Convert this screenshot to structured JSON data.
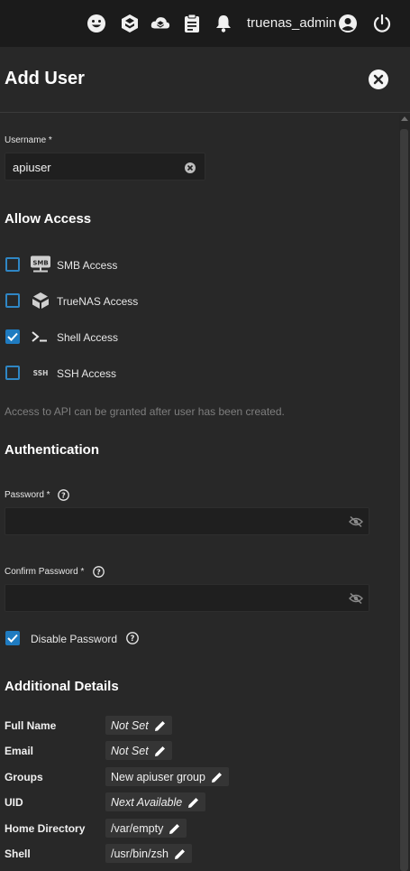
{
  "topbar": {
    "username": "truenas_admin",
    "icons": [
      "feedback-icon",
      "truenas-logo-icon",
      "truecommand-icon",
      "jobs-icon",
      "notifications-icon",
      "account-icon",
      "power-icon"
    ]
  },
  "panel": {
    "title": "Add User"
  },
  "form": {
    "username": {
      "label": "Username *",
      "value": "apiuser"
    },
    "allow_access": {
      "title": "Allow Access",
      "items": [
        {
          "label": "SMB Access",
          "checked": false,
          "icon": "smb-icon"
        },
        {
          "label": "TrueNAS Access",
          "checked": false,
          "icon": "truenas-icon"
        },
        {
          "label": "Shell Access",
          "checked": true,
          "icon": "terminal-icon"
        },
        {
          "label": "SSH Access",
          "checked": false,
          "icon": "ssh-icon"
        }
      ],
      "hint": "Access to API can be granted after user has been created."
    },
    "authentication": {
      "title": "Authentication",
      "password_label": "Password *",
      "confirm_label": "Confirm Password *",
      "disable_password_label": "Disable Password",
      "disable_password_checked": true
    },
    "details": {
      "title": "Additional Details",
      "rows": [
        {
          "key": "Full Name",
          "value": "Not Set",
          "italic": true
        },
        {
          "key": "Email",
          "value": "Not Set",
          "italic": true
        },
        {
          "key": "Groups",
          "value": "New apiuser group",
          "italic": false
        },
        {
          "key": "UID",
          "value": "Next Available",
          "italic": true
        },
        {
          "key": "Home Directory",
          "value": "/var/empty",
          "italic": false
        },
        {
          "key": "Shell",
          "value": "/usr/bin/zsh",
          "italic": false
        }
      ]
    }
  },
  "colors": {
    "accent": "#1f7bc0",
    "background": "#282828",
    "topbar": "#1b1b1b"
  }
}
